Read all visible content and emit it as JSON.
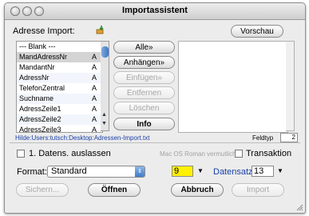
{
  "window": {
    "title": "Importassistent"
  },
  "header": {
    "adresse_label": "Adresse Import:",
    "vorschau_button": "Vorschau"
  },
  "fields_list": {
    "rows": [
      {
        "name": "--- Blank ---",
        "type": ""
      },
      {
        "name": "MandAdressNr",
        "type": "A"
      },
      {
        "name": "MandantNr",
        "type": "A"
      },
      {
        "name": "AdressNr",
        "type": "A"
      },
      {
        "name": "TelefonZentral",
        "type": "A"
      },
      {
        "name": "Suchname",
        "type": "A"
      },
      {
        "name": "AdressZeile1",
        "type": "A"
      },
      {
        "name": "AdressZeile2",
        "type": "A"
      },
      {
        "name": "AdressZeile3",
        "type": "A"
      }
    ]
  },
  "mid_buttons": {
    "alle": "Alle»",
    "anhangen": "Anhängen»",
    "einfugen": "Einfügen»",
    "entfernen": "Entfernen",
    "loschen": "Löschen",
    "info": "Info"
  },
  "file_path": "Hilde:Users:tutsch:Desktop:Adressen-Import.txt",
  "feldtyp": {
    "label": "Feldtyp",
    "value": "2"
  },
  "options": {
    "skip_first": "1. Datens. auslassen",
    "encoding_hint": "Mac OS Roman vermutlich",
    "transaktion": "Transaktion"
  },
  "format": {
    "label": "Format:",
    "selected": "Standard"
  },
  "delimiter_value": "9",
  "datensatz": {
    "label": "Datensatz",
    "value": "13"
  },
  "bottom_buttons": {
    "sichern": "Sichern...",
    "offnen": "Öffnen",
    "abbruch": "Abbruch",
    "import": "Import"
  },
  "colors": {
    "accent_blue": "#1a3fa6",
    "selected_row": "#d4d4d4",
    "highlight_yellow": "#fff200"
  }
}
